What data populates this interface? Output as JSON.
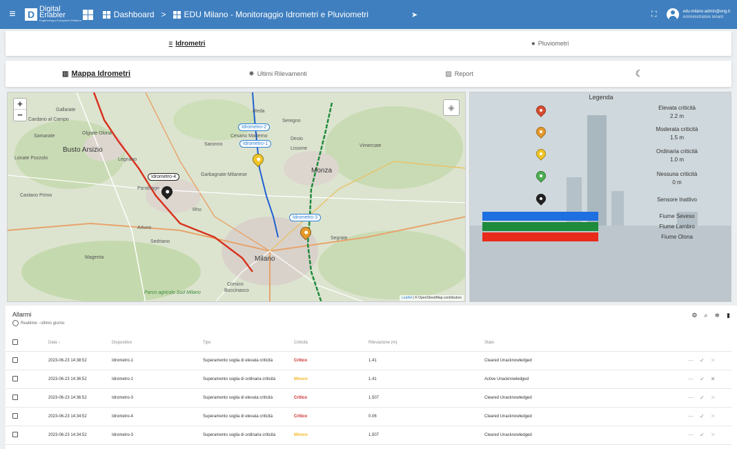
{
  "topbar": {
    "logo_line1": "Digital",
    "logo_line2": "Enabler",
    "logo_tagline": "Engineering's Ecosystem Platform",
    "crumb_home": "Dashboard",
    "crumb_sep": ">",
    "crumb_page": "EDU Milano - Monitoraggio Idrometri e Pluviometri",
    "user_email": "edu-milano.admin@eng.it",
    "user_role": "Amministratore tenant"
  },
  "tabs_top": [
    {
      "label": "Idrometri",
      "icon": "waves-icon"
    },
    {
      "label": "Pluviometri",
      "icon": "drop-icon"
    }
  ],
  "tabs_second": [
    {
      "label": "Mappa Idrometri",
      "icon": "map-icon"
    },
    {
      "label": "Ultimi Rilevamenti",
      "icon": "bug-icon"
    },
    {
      "label": "Report",
      "icon": "chart-icon"
    },
    {
      "label": "",
      "icon": "moon-icon"
    }
  ],
  "map": {
    "zoom_in": "+",
    "zoom_out": "−",
    "attribution_leaflet": "Leaflet",
    "attribution_rest": " | © OpenStreetMap contributors",
    "place_labels": {
      "gallarate": "Gallarate",
      "cardano": "Cardano al Campo",
      "samarate": "Samarate",
      "olgiate": "Olgiate Olona",
      "busto": "Busto Arsizio",
      "lonate": "Lonate Pozzolo",
      "legnano": "Legnano",
      "parabiago": "Parabiago",
      "castano": "Castano Primo",
      "magenta": "Magenta",
      "sedriano": "Sedriano",
      "arluno": "Arluno",
      "rho": "Rho",
      "saronno": "Saronno",
      "garbagnate": "Garbagnate Milanese",
      "cesano": "Cesano Maderno",
      "meda": "Meda",
      "seregno": "Seregno",
      "desio": "Desio",
      "monza": "Monza",
      "lissone": "Lissone",
      "vimercate": "Vimercate",
      "milano": "Milano",
      "corsico": "Corsico",
      "buccinasco": "Buccinasco",
      "segrate": "Segrate",
      "parco": "Parco agricolo Sud Milano"
    },
    "pins": {
      "idr1": "Idrometro-1",
      "idr2": "Idrometro-2",
      "idr3": "Idrometro-3",
      "idr4": "Idrometro-4"
    }
  },
  "legend": {
    "title": "Legenda",
    "items": [
      {
        "label": "Elevata criticità",
        "value": "2.2 m",
        "color": "#d84c2f"
      },
      {
        "label": "Moderata criticità",
        "value": "1.5 m",
        "color": "#e59a2c"
      },
      {
        "label": "Ordinaria criticità",
        "value": "1.0 m",
        "color": "#f0c528"
      },
      {
        "label": "Nessuna criticità",
        "value": "0 m",
        "color": "#4caf50"
      },
      {
        "label": "Sensore Inattivo",
        "value": "",
        "color": "#222222"
      }
    ],
    "rivers": [
      {
        "label": "Fiume Seveso",
        "color": "#1e6fe0"
      },
      {
        "label": "Fiume Lambro",
        "color": "#1e8a3c"
      },
      {
        "label": "Fiume Olona",
        "color": "#e82a1a"
      }
    ]
  },
  "alarms": {
    "title": "Allarmi",
    "subtitle": "Realtime - ultimo giorno",
    "tools": [
      "gear-icon",
      "search-icon",
      "filter-icon",
      "columns-icon"
    ],
    "columns": [
      "Data ↓",
      "Dispositivo",
      "Tipo",
      "Criticità",
      "Rilevazione (m)",
      "Stato"
    ],
    "rows": [
      {
        "date": "2023-06-23 14:38:52",
        "device": "Idrometro-1",
        "type": "Superamento soglia di elevata criticità",
        "sev": "Critico",
        "value": "1.41",
        "state": "Cleared Unacknowledged"
      },
      {
        "date": "2023-06-23 14:36:52",
        "device": "Idrometro-1",
        "type": "Superamento soglia di ordinaria criticità",
        "sev": "Minore",
        "value": "1.41",
        "state": "Active Unacknowledged"
      },
      {
        "date": "2023-06-23 14:36:52",
        "device": "Idrometro-3",
        "type": "Superamento soglia di elevata criticità",
        "sev": "Critico",
        "value": "1.507",
        "state": "Cleared Unacknowledged"
      },
      {
        "date": "2023-06-23 14:34:52",
        "device": "Idrometro-4",
        "type": "Superamento soglia di elevata criticità",
        "sev": "Critico",
        "value": "0.06",
        "state": "Cleared Unacknowledged"
      },
      {
        "date": "2023-06-23 14:34:52",
        "device": "Idrometro-3",
        "type": "Superamento soglia di ordinaria criticità",
        "sev": "Minore",
        "value": "1.507",
        "state": "Cleared Unacknowledged"
      }
    ],
    "row_actions": [
      "⋯",
      "✓",
      "✕"
    ]
  },
  "colors": {
    "topbar": "#3f7fbf",
    "critical": "#c62828",
    "minor": "#f2b824"
  }
}
